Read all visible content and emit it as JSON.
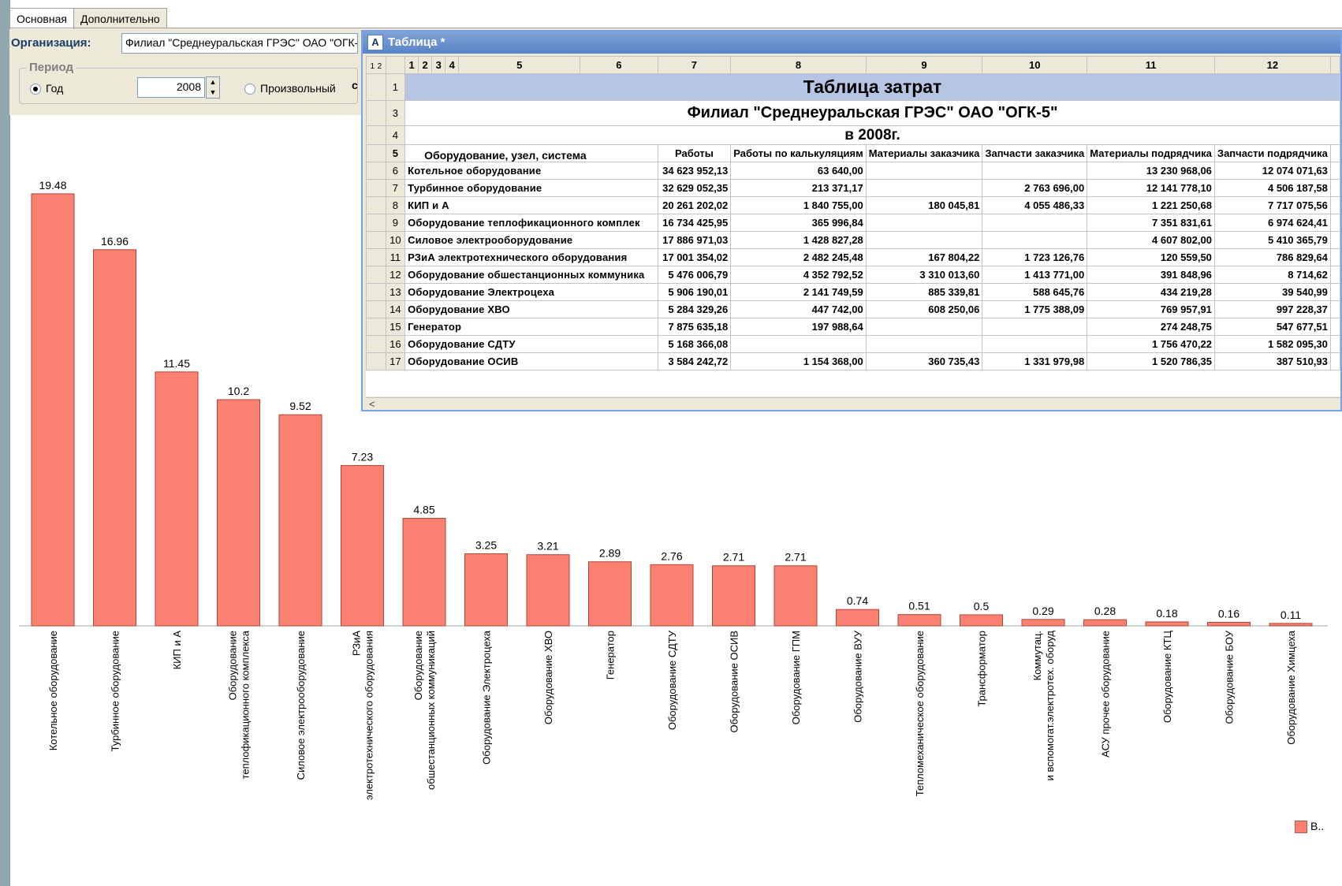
{
  "tabs": [
    "Основная",
    "Дополнительно"
  ],
  "form": {
    "org_label": "Организация:",
    "org_value": "Филиал \"Среднеуральская ГРЭС\" ОАО \"ОГК-5\"",
    "period_label": "Период",
    "radio_year": "Год",
    "year_value": "2008",
    "radio_custom": "Произвольный",
    "c_label": "с"
  },
  "window": {
    "title": "Таблица *",
    "icon": "table-icon",
    "scroll_left": "<"
  },
  "table": {
    "level_buttons": [
      "1",
      "2"
    ],
    "col_headers": [
      "1",
      "2",
      "3",
      "4",
      "5",
      "6",
      "7",
      "8",
      "9",
      "10",
      "11",
      "12"
    ],
    "row1_title": "Таблица затрат",
    "row3_title": "Филиал \"Среднеуральская ГРЭС\" ОАО \"ОГК-5\"",
    "row4_title": "в 2008г.",
    "header": {
      "name": "Оборудование, узел, система",
      "c7": "Работы",
      "c8": "Работы по калькуляциям",
      "c9": "Материалы заказчика",
      "c10": "Запчасти заказчика",
      "c11": "Материалы подрядчика",
      "c12": "Запчасти подрядчика"
    },
    "row_numbers": {
      "r1": "1",
      "r3": "3",
      "r4": "4",
      "r5": "5"
    },
    "rows": [
      {
        "n": "6",
        "name": "Котельное оборудование",
        "c7": "34 623 952,13",
        "c8": "63 640,00",
        "c9": "",
        "c10": "",
        "c11": "13 230 968,06",
        "c12": "12 074 071,63"
      },
      {
        "n": "7",
        "name": "Турбинное оборудование",
        "c7": "32 629 052,35",
        "c8": "213 371,17",
        "c9": "",
        "c10": "2 763 696,00",
        "c11": "12 141 778,10",
        "c12": "4 506 187,58"
      },
      {
        "n": "8",
        "name": "КИП и  А",
        "c7": "20 261 202,02",
        "c8": "1 840 755,00",
        "c9": "180 045,81",
        "c10": "4 055 486,33",
        "c11": "1 221 250,68",
        "c12": "7 717 075,56"
      },
      {
        "n": "9",
        "name": "Оборудование теплофикационного комплек",
        "c7": "16 734 425,95",
        "c8": "365 996,84",
        "c9": "",
        "c10": "",
        "c11": "7 351 831,61",
        "c12": "6 974 624,41"
      },
      {
        "n": "10",
        "name": "Силовое электрооборудование",
        "c7": "17 886 971,03",
        "c8": "1 428 827,28",
        "c9": "",
        "c10": "",
        "c11": "4 607 802,00",
        "c12": "5 410 365,79"
      },
      {
        "n": "11",
        "name": "РЗиА электротехнического оборудования",
        "c7": "17 001 354,02",
        "c8": "2 482 245,48",
        "c9": "167 804,22",
        "c10": "1 723 126,76",
        "c11": "120 559,50",
        "c12": "786 829,64"
      },
      {
        "n": "12",
        "name": "Оборудование обшестанционных коммуника",
        "c7": "5 476 006,79",
        "c8": "4 352 792,52",
        "c9": "3 310 013,60",
        "c10": "1 413 771,00",
        "c11": "391 848,96",
        "c12": "8 714,62"
      },
      {
        "n": "13",
        "name": "Оборудование Электроцеха",
        "c7": "5 906 190,01",
        "c8": "2 141 749,59",
        "c9": "885 339,81",
        "c10": "588 645,76",
        "c11": "434 219,28",
        "c12": "39 540,99"
      },
      {
        "n": "14",
        "name": "Оборудование ХВО",
        "c7": "5 284 329,26",
        "c8": "447 742,00",
        "c9": "608 250,06",
        "c10": "1 775 388,09",
        "c11": "769 957,91",
        "c12": "997 228,37"
      },
      {
        "n": "15",
        "name": "Генератор",
        "c7": "7 875 635,18",
        "c8": "197 988,64",
        "c9": "",
        "c10": "",
        "c11": "274 248,75",
        "c12": "547 677,51"
      },
      {
        "n": "16",
        "name": "Оборудование СДТУ",
        "c7": "5 168 366,08",
        "c8": "",
        "c9": "",
        "c10": "",
        "c11": "1 756 470,22",
        "c12": "1 582 095,30"
      },
      {
        "n": "17",
        "name": "Оборудование ОСИВ",
        "c7": "3 584 242,72",
        "c8": "1 154 368,00",
        "c9": "360 735,43",
        "c10": "1 331 979,98",
        "c11": "1 520 786,35",
        "c12": "387 510,93"
      }
    ]
  },
  "chart_data": {
    "type": "bar",
    "categories": [
      "Котельное оборудование",
      "Турбинное оборудование",
      "КИП и А",
      "Оборудование теплофикационного комплекса",
      "Силовое электрооборудование",
      "РЗиА электротехнического оборудования",
      "Оборудование обшестанционных коммуникаций",
      "Оборудование Электроцеха",
      "Оборудование ХВО",
      "Генератор",
      "Оборудование СДТУ",
      "Оборудование ОСИВ",
      "Оборудование ГПМ",
      "Оборудование ВУУ",
      "Тепломеханическое оборудование",
      "Трансформатор",
      "Коммутац. и вспомогат.электротех. оборуд",
      "АСУ прочее оборудование",
      "Оборудование КТЦ",
      "Оборудование БОУ",
      "Оборудование Химцеха"
    ],
    "values": [
      19.48,
      16.96,
      11.45,
      10.2,
      9.52,
      7.23,
      4.85,
      3.25,
      3.21,
      2.89,
      2.76,
      2.71,
      2.71,
      0.74,
      0.51,
      0.5,
      0.29,
      0.28,
      0.18,
      0.16,
      0.11
    ],
    "value_labels": [
      "19.48",
      "16.96",
      "11.45",
      "10.2",
      "9.52",
      "7.23",
      "4.85",
      "3.25",
      "3.21",
      "2.89",
      "2.76",
      "2.71",
      "2.71",
      "0.74",
      "0.51",
      "0.5",
      "0.29",
      "0.28",
      "0.18",
      "0.16",
      "0.11"
    ],
    "bar_color": "#fa8072",
    "ylim": [
      0,
      20
    ],
    "legend": {
      "label": "В..",
      "position": "bottom-right"
    },
    "title": "",
    "xlabel": "",
    "ylabel": ""
  }
}
